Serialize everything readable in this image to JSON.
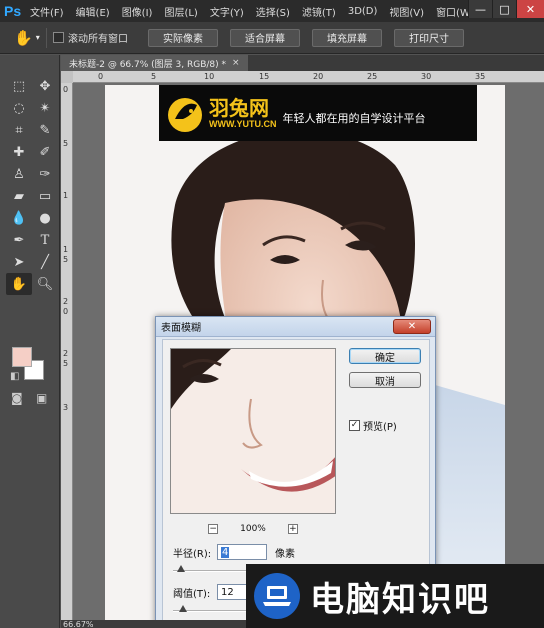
{
  "app": {
    "logo": "Ps",
    "menu": [
      "文件(F)",
      "编辑(E)",
      "图像(I)",
      "图层(L)",
      "文字(Y)",
      "选择(S)",
      "滤镜(T)",
      "3D(D)",
      "视图(V)",
      "窗口(W"
    ],
    "window_controls": [
      "—",
      "□",
      "✕"
    ]
  },
  "options": {
    "scroll_all_label": "滚动所有窗口",
    "buttons": [
      "实际像素",
      "适合屏幕",
      "填充屏幕",
      "打印尺寸"
    ]
  },
  "document": {
    "tab_title": "未标题-2 @ 66.7% (图层 3, RGB/8) *",
    "tab_close": "×",
    "zoom_status": "66.67%"
  },
  "rulers": {
    "top": [
      "0",
      "5",
      "10",
      "15",
      "20",
      "25",
      "30",
      "35"
    ],
    "left": [
      "0",
      "5",
      "1",
      "1",
      "5",
      "2",
      "0",
      "2",
      "5",
      "3"
    ]
  },
  "colors": {
    "foreground": "#f5cfc6",
    "background": "#ffffff",
    "accent": "#31a8ff"
  },
  "logo_banner": {
    "brand_cn": "羽兔网",
    "url": "WWW.YUTU.CN",
    "slogan": "年轻人都在用的自学设计平台"
  },
  "dialog": {
    "title": "表面模糊",
    "close": "✕",
    "ok_label": "确定",
    "cancel_label": "取消",
    "preview_label": "预览(P)",
    "preview_checked": true,
    "zoom_out": "−",
    "zoom_in": "+",
    "zoom_level": "100%",
    "radius_label": "半径(R):",
    "radius_value": "4",
    "radius_unit": "像素",
    "threshold_label": "阈值(T):",
    "threshold_value": "12"
  },
  "watermark": {
    "text": "电脑知识吧"
  }
}
